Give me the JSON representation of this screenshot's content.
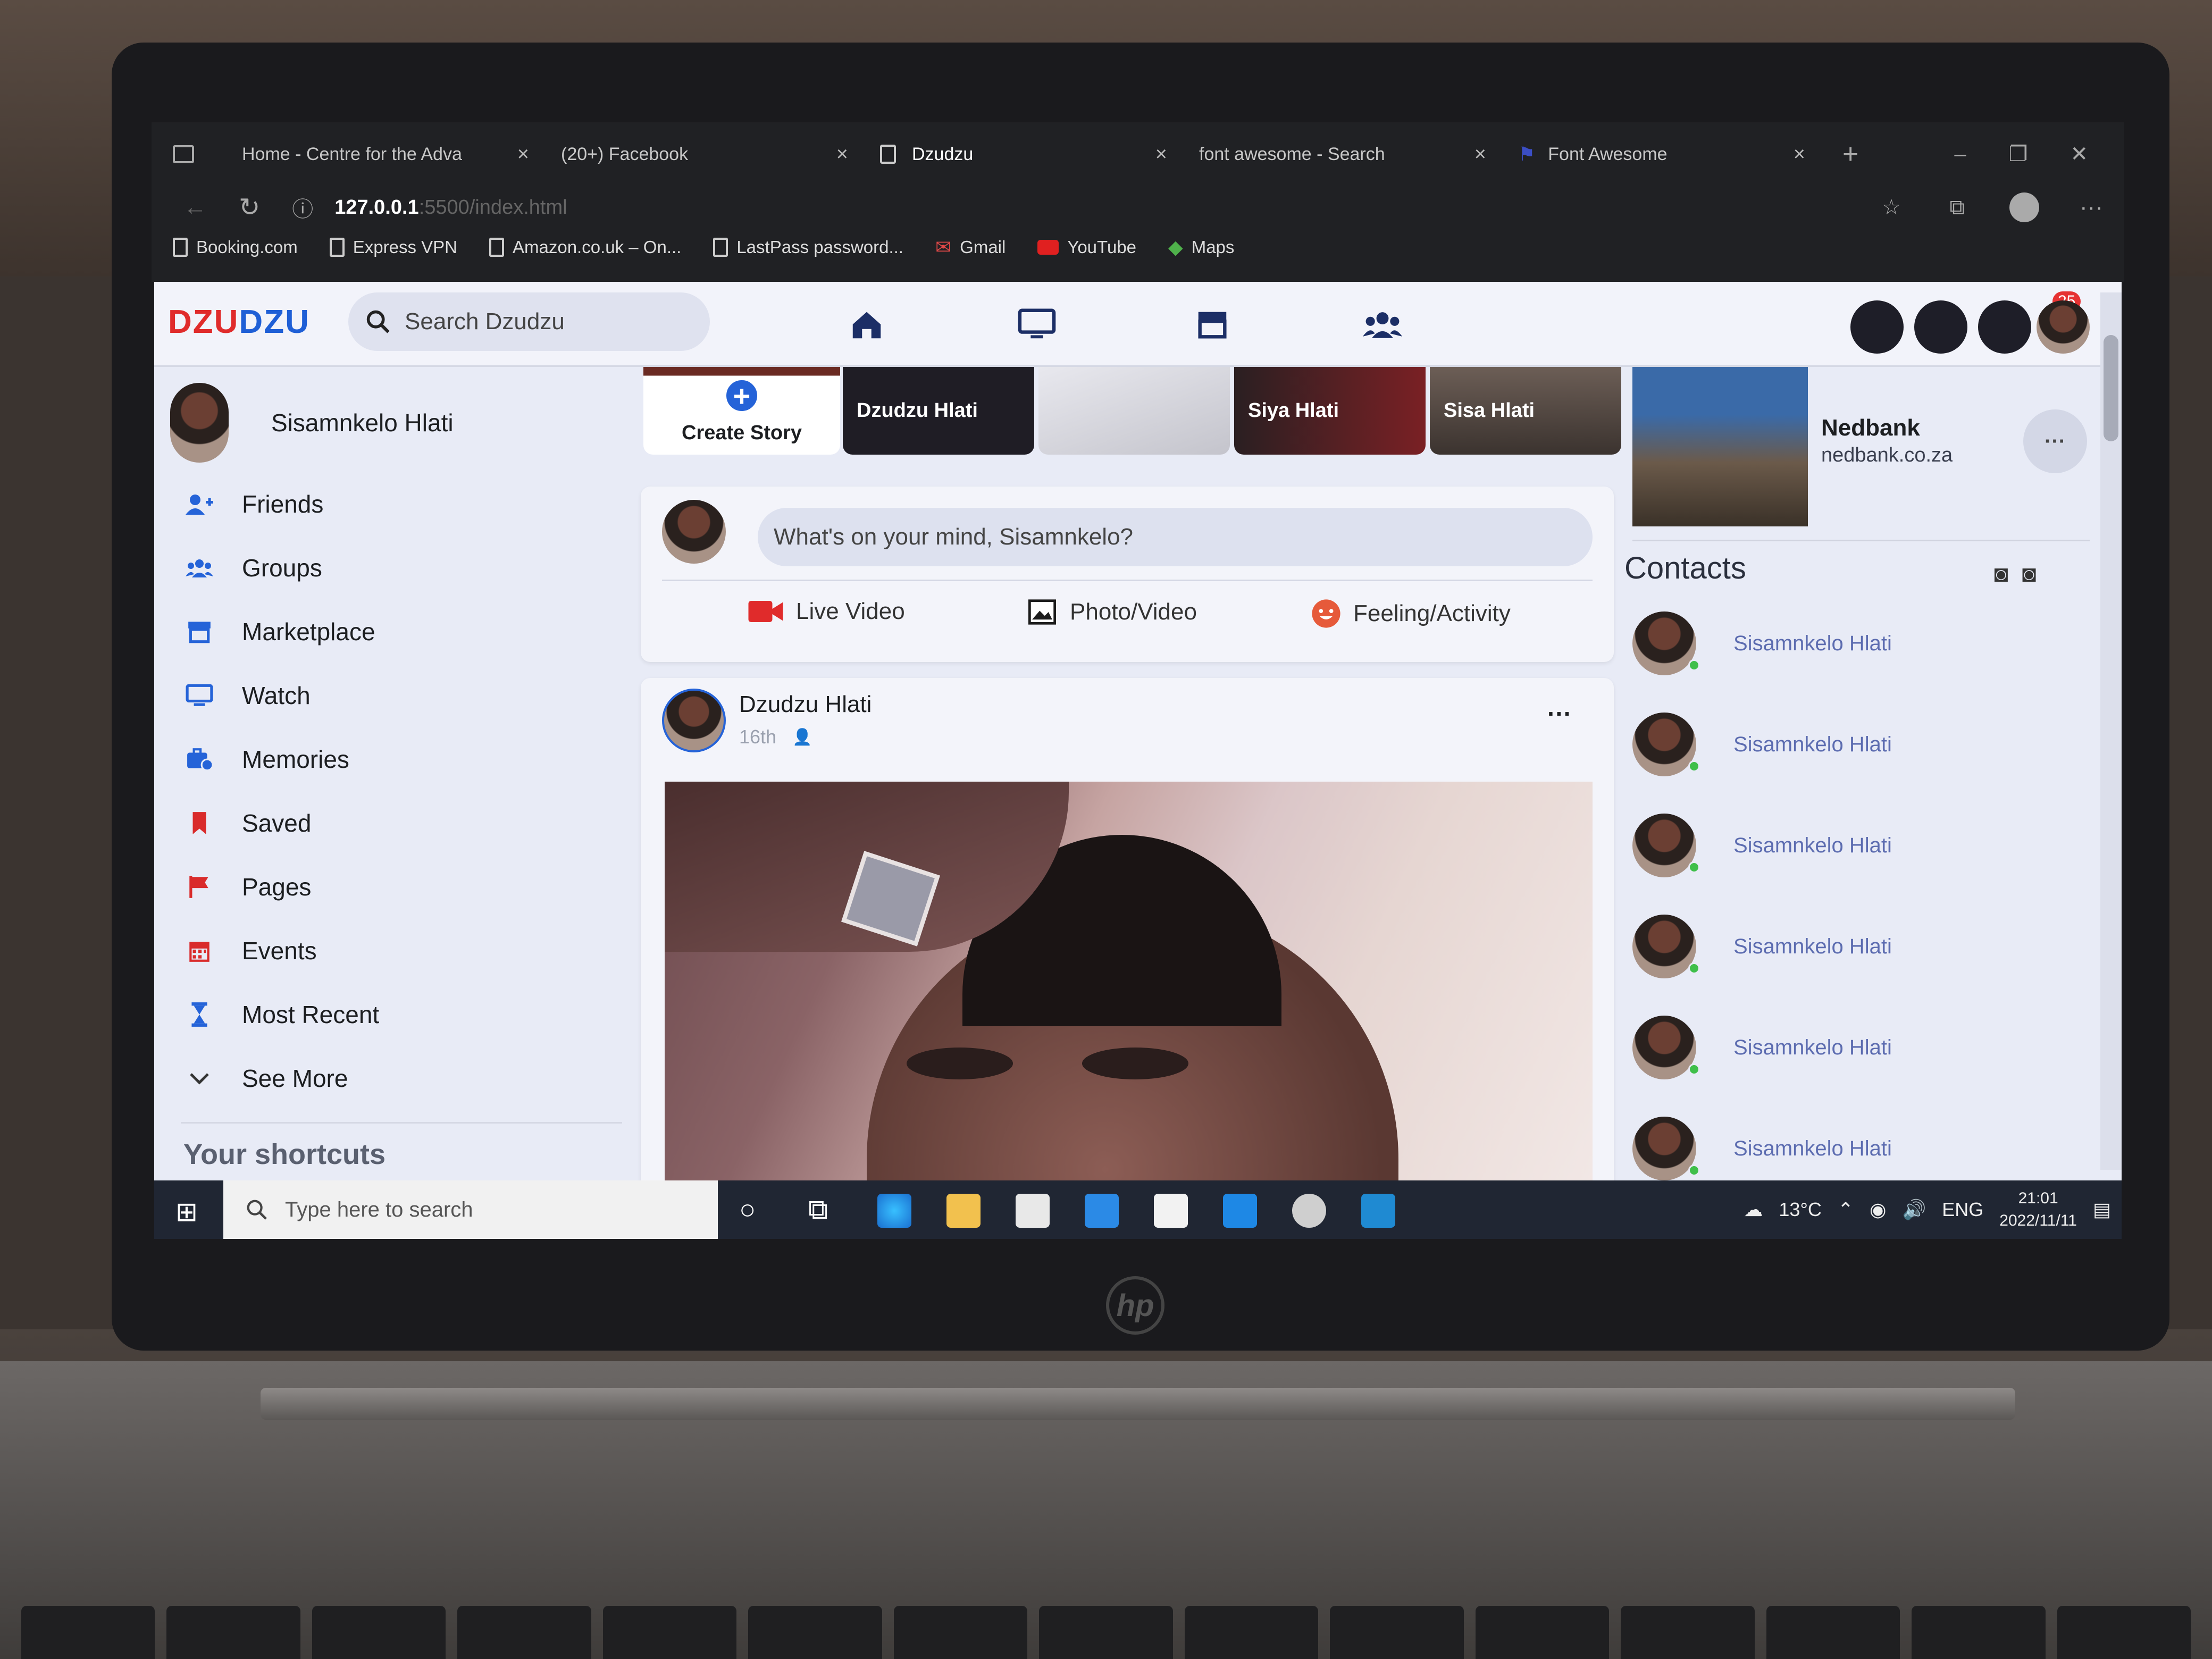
{
  "browser": {
    "tabs": [
      {
        "label": "Home - Centre for the Adva"
      },
      {
        "label": "(20+) Facebook"
      },
      {
        "label": "Dzudzu"
      },
      {
        "label": "font awesome - Search"
      },
      {
        "label": "Font Awesome"
      }
    ],
    "new_tab": "+",
    "close_glyph": "×",
    "url_host": "127.0.0.1",
    "url_rest": ":5500/index.html",
    "bookmarks": [
      "Booking.com",
      "Express VPN",
      "Amazon.co.uk – On...",
      "LastPass password...",
      "Gmail",
      "YouTube",
      "Maps"
    ]
  },
  "app": {
    "logo_red": "DZU",
    "logo_blue": "DZU",
    "search_placeholder": "Search Dzudzu",
    "nav_icons": [
      "home-icon",
      "tv-icon",
      "store-icon",
      "users-icon"
    ],
    "notification_count": "25"
  },
  "sidebar": {
    "user_name": "Sisamnkelo Hlati",
    "items": [
      {
        "label": "Friends",
        "icon": "user-plus-icon"
      },
      {
        "label": "Groups",
        "icon": "users-icon"
      },
      {
        "label": "Marketplace",
        "icon": "store-icon"
      },
      {
        "label": "Watch",
        "icon": "tv-icon"
      },
      {
        "label": "Memories",
        "icon": "briefcase-clock-icon"
      },
      {
        "label": "Saved",
        "icon": "bookmark-icon"
      },
      {
        "label": "Pages",
        "icon": "flag-icon"
      },
      {
        "label": "Events",
        "icon": "calendar-icon"
      },
      {
        "label": "Most Recent",
        "icon": "hourglass-icon"
      },
      {
        "label": "See More",
        "icon": "chevron-down-icon"
      }
    ],
    "shortcuts_title": "Your shortcuts"
  },
  "stories": {
    "create_label": "Create Story",
    "items": [
      {
        "name": "Dzudzu Hlati"
      },
      {
        "name": ""
      },
      {
        "name": "Siya Hlati"
      },
      {
        "name": "Sisa Hlati"
      }
    ]
  },
  "composer": {
    "placeholder": "What's on your mind, Sisamnkelo?",
    "actions": [
      "Live Video",
      "Photo/Video",
      "Feeling/Activity"
    ]
  },
  "post": {
    "author": "Dzudzu Hlati",
    "time": "16th",
    "more": "···"
  },
  "right": {
    "sponsor_name": "Nedbank",
    "sponsor_url": "nedbank.co.za",
    "more": "···",
    "contacts_title": "Contacts",
    "contacts": [
      "Sisamnkelo Hlati",
      "Sisamnkelo Hlati",
      "Sisamnkelo Hlati",
      "Sisamnkelo Hlati",
      "Sisamnkelo Hlati",
      "Sisamnkelo Hlati"
    ]
  },
  "taskbar": {
    "search_placeholder": "Type here to search",
    "temperature": "13°C",
    "language": "ENG",
    "time": "21:01",
    "date": "2022/11/11"
  },
  "device": {
    "brand": "hp"
  }
}
